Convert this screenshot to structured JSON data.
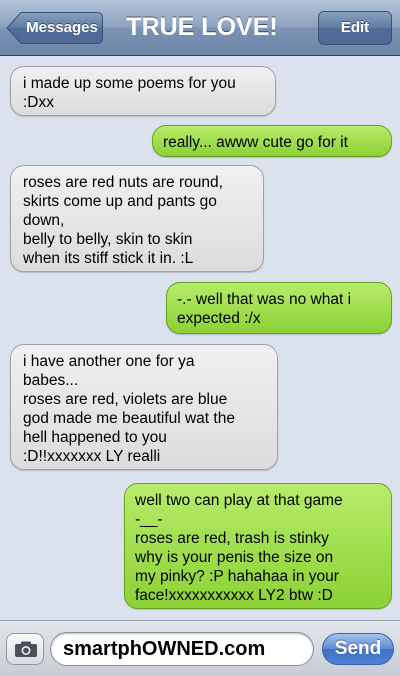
{
  "header": {
    "back_label": "Messages",
    "title": "TRUE LOVE!",
    "edit_label": "Edit"
  },
  "messages": [
    {
      "sender": "them",
      "text": "i made up some poems for you\n:Dxx"
    },
    {
      "sender": "me",
      "text": "really... awww cute go for it"
    },
    {
      "sender": "them",
      "text": "roses are red nuts are round,\nskirts come up and pants go\ndown,\nbelly to belly, skin to skin\nwhen its stiff stick it in. :L"
    },
    {
      "sender": "me",
      "text": "-.- well that was no what i\nexpected :/x"
    },
    {
      "sender": "them",
      "text": "i have another one for ya\nbabes...\nroses are red, violets are blue\ngod made me beautiful wat the\nhell happened to you\n:D!!xxxxxxx LY realli"
    },
    {
      "sender": "me",
      "text": "well two can play at that game\n-__-\nroses are red, trash is stinky\nwhy is your penis the size on\nmy pinky? :P hahahaa in your\nface!xxxxxxxxxxx LY2 btw :D"
    }
  ],
  "composer": {
    "value": "smartphOWNED.com",
    "send_label": "Send",
    "camera_icon": "camera-icon"
  },
  "colors": {
    "outgoing_bubble": "#9bdc48",
    "incoming_bubble": "#e6e6e6",
    "thread_background": "#dbe2ed",
    "header": "#8ea3c0"
  }
}
